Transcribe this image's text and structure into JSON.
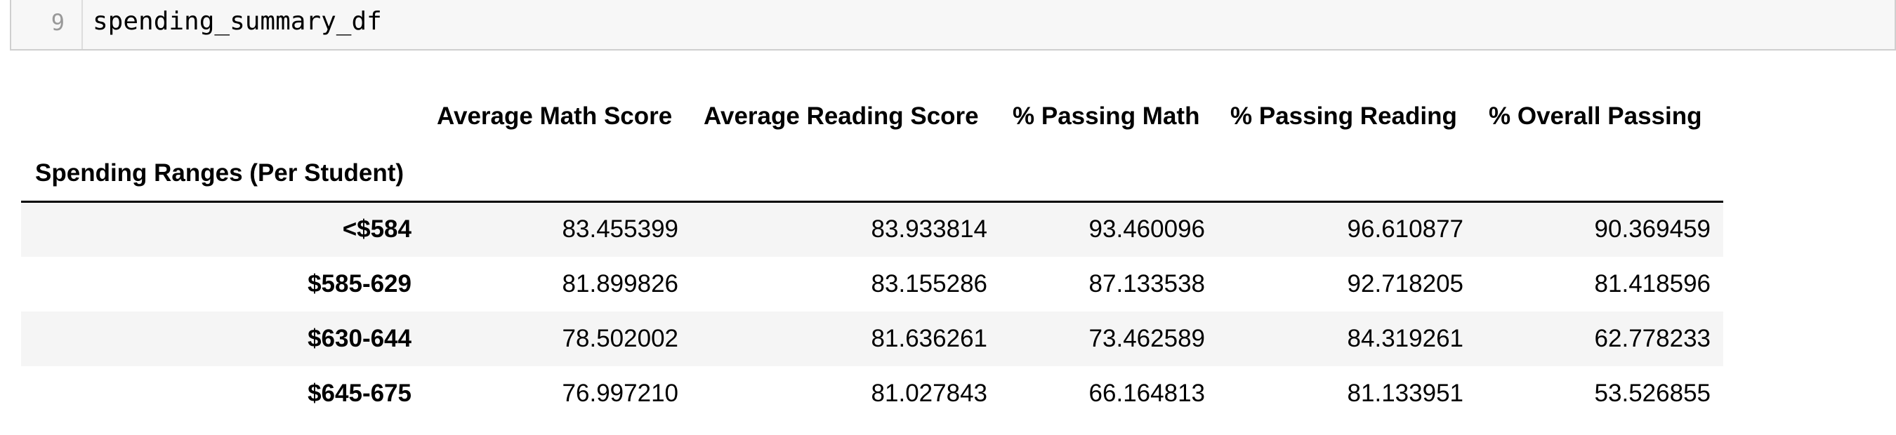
{
  "code_cell": {
    "line_number": "9",
    "code": "spending_summary_df"
  },
  "table": {
    "columns": [
      "Average Math Score",
      "Average Reading Score",
      "% Passing Math",
      "% Passing Reading",
      "% Overall Passing"
    ],
    "index_name": "Spending Ranges (Per Student)",
    "rows": [
      {
        "index": "<$584",
        "values": [
          "83.455399",
          "83.933814",
          "93.460096",
          "96.610877",
          "90.369459"
        ]
      },
      {
        "index": "$585-629",
        "values": [
          "81.899826",
          "83.155286",
          "87.133538",
          "92.718205",
          "81.418596"
        ]
      },
      {
        "index": "$630-644",
        "values": [
          "78.502002",
          "81.636261",
          "73.462589",
          "84.319261",
          "62.778233"
        ]
      },
      {
        "index": "$645-675",
        "values": [
          "76.997210",
          "81.027843",
          "66.164813",
          "81.133951",
          "53.526855"
        ]
      }
    ]
  }
}
